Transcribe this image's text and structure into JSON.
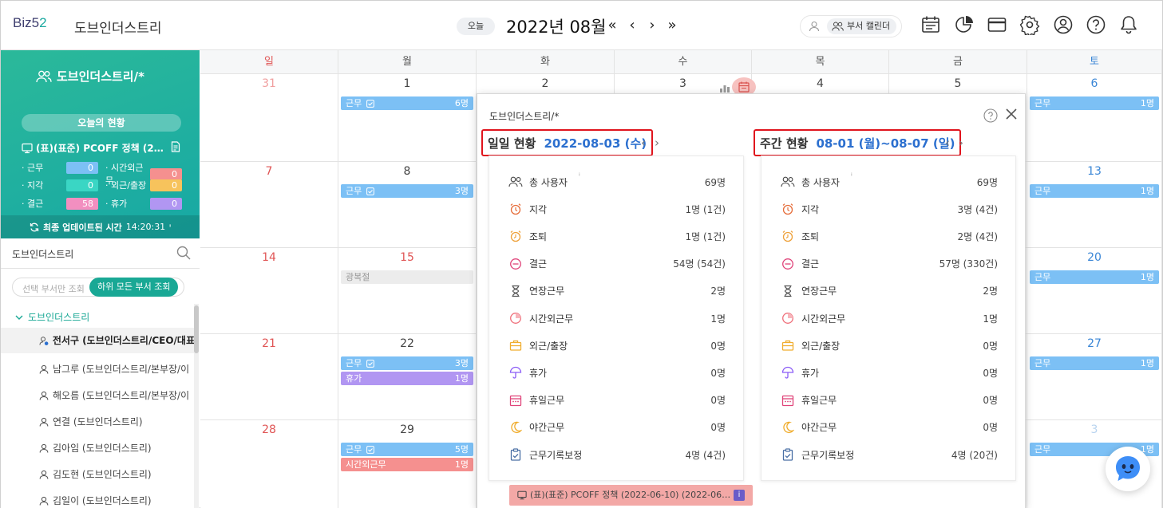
{
  "header": {
    "logo_main": "Biz5",
    "logo_accent": "2",
    "company": "도브인더스트리",
    "today_label": "오늘",
    "month": "2022년 08월",
    "nav": {
      "prev_year": "«",
      "prev": "‹",
      "next": "›",
      "next_year": "»"
    },
    "calendar_toggle": "부서 캘린더",
    "icons": [
      "timesheet-icon",
      "chart-pie-icon",
      "card-icon",
      "gear-icon",
      "user-circle-icon",
      "help-icon",
      "bell-icon"
    ]
  },
  "sidebar": {
    "dept_title": "도브인더스트리/*",
    "status_label": "오늘의 현황",
    "policy": "(표)(표준) PCOFF 정책 (2…",
    "stats": [
      {
        "label": "· 근무",
        "value": "0",
        "color": "#7cc0f5"
      },
      {
        "label": "· 시간외근무",
        "value": "0",
        "color": "#f5908f"
      },
      {
        "label": "· 지각",
        "value": "0",
        "color": "#3ad6c4"
      },
      {
        "label": "· 외근/출장",
        "value": "0",
        "color": "#f7c35c"
      },
      {
        "label": "· 결근",
        "value": "58",
        "color": "#f28fc0"
      },
      {
        "label": "· 휴가",
        "value": "0",
        "color": "#b196f2"
      }
    ],
    "updated_label": "최종 업데이트된 시간",
    "updated_time": "14:20:31",
    "search_text": "도브인더스트리",
    "filter_placeholder": "선택 부서만 조회",
    "filter_active": "하위 모든 부서 조회",
    "tree_root": "도브인더스트리",
    "members": [
      "전서구 (도브인더스트리/CEO/대표",
      "남그루 (도브인더스트리/본부장/이",
      "해오름 (도브인더스트리/본부장/이",
      "연결 (도브인더스트리)",
      "김아임 (도브인더스트리)",
      "김도현 (도브인더스트리)",
      "김일이 (도브인더스트리)"
    ]
  },
  "calendar": {
    "weekdays": [
      "일",
      "월",
      "화",
      "수",
      "목",
      "금",
      "토"
    ],
    "weeks": [
      [
        "31",
        "1",
        "2",
        "3",
        "4",
        "5",
        "6"
      ],
      [
        "7",
        "8",
        "",
        "",
        "",
        "",
        "13"
      ],
      [
        "14",
        "15",
        "",
        "",
        "",
        "",
        "20"
      ],
      [
        "21",
        "22",
        "",
        "",
        "",
        "",
        "27"
      ],
      [
        "28",
        "29",
        "",
        "",
        "",
        "",
        "3"
      ]
    ],
    "events": {
      "w0_mon": {
        "label": "근무",
        "count": "6명"
      },
      "w0_sat": {
        "label": "근무",
        "count": "1명"
      },
      "w1_mon": {
        "label": "근무",
        "count": "3명"
      },
      "w1_sat": {
        "label": "근무",
        "count": "1명"
      },
      "w2_mon": {
        "label": "광복절"
      },
      "w2_sat": {
        "label": "근무",
        "count": "1명"
      },
      "w3_mon_a": {
        "label": "근무",
        "count": "3명"
      },
      "w3_mon_b": {
        "label": "휴가",
        "count": "1명"
      },
      "w3_sat": {
        "label": "근무",
        "count": "1명"
      },
      "w4_mon_a": {
        "label": "근무",
        "count": "5명"
      },
      "w4_mon_b": {
        "label": "시간외근무",
        "count": "1명"
      },
      "w4_sat": {
        "label": "근무",
        "count": "1명"
      }
    }
  },
  "popup": {
    "title": "도브인더스트리/*",
    "daily_label": "일일 현황",
    "daily_date": "2022-08-03 (수)",
    "weekly_label": "주간 현황",
    "weekly_range": "08-01 (월)~08-07 (일)",
    "daily": [
      {
        "icon": "users-icon",
        "name": "총 사용자",
        "value": "69명"
      },
      {
        "icon": "alarm-late-icon",
        "name": "지각",
        "value": "1명 (1건)"
      },
      {
        "icon": "alarm-early-icon",
        "name": "조퇴",
        "value": "1명 (1건)"
      },
      {
        "icon": "absent-icon",
        "name": "결근",
        "value": "54명 (54건)"
      },
      {
        "icon": "hourglass-icon",
        "name": "연장근무",
        "value": "2명"
      },
      {
        "icon": "overtime-icon",
        "name": "시간외근무",
        "value": "1명"
      },
      {
        "icon": "briefcase-icon",
        "name": "외근/출장",
        "value": "0명"
      },
      {
        "icon": "umbrella-icon",
        "name": "휴가",
        "value": "0명"
      },
      {
        "icon": "calendar-holiday-icon",
        "name": "휴일근무",
        "value": "0명"
      },
      {
        "icon": "moon-icon",
        "name": "야간근무",
        "value": "0명"
      },
      {
        "icon": "clipboard-check-icon",
        "name": "근무기록보정",
        "value": "4명 (4건)"
      }
    ],
    "weekly": [
      {
        "icon": "users-icon",
        "name": "총 사용자",
        "value": "69명"
      },
      {
        "icon": "alarm-late-icon",
        "name": "지각",
        "value": "3명 (4건)"
      },
      {
        "icon": "alarm-early-icon",
        "name": "조퇴",
        "value": "2명 (4건)"
      },
      {
        "icon": "absent-icon",
        "name": "결근",
        "value": "57명 (330건)"
      },
      {
        "icon": "hourglass-icon",
        "name": "연장근무",
        "value": "2명"
      },
      {
        "icon": "overtime-icon",
        "name": "시간외근무",
        "value": "1명"
      },
      {
        "icon": "briefcase-icon",
        "name": "외근/출장",
        "value": "0명"
      },
      {
        "icon": "umbrella-icon",
        "name": "휴가",
        "value": "0명"
      },
      {
        "icon": "calendar-holiday-icon",
        "name": "휴일근무",
        "value": "0명"
      },
      {
        "icon": "moon-icon",
        "name": "야간근무",
        "value": "0명"
      },
      {
        "icon": "clipboard-check-icon",
        "name": "근무기록보정",
        "value": "4명 (20건)"
      }
    ],
    "bottom_policy": "(표)(표준) PCOFF 정책 (2022-06-10) (2022-06…",
    "bottom_info": "i"
  },
  "colors": {
    "accent": "#19a895",
    "event_blue": "#7cc0f5",
    "highlight": "#e0141d",
    "date_blue": "#2b6fcf"
  }
}
